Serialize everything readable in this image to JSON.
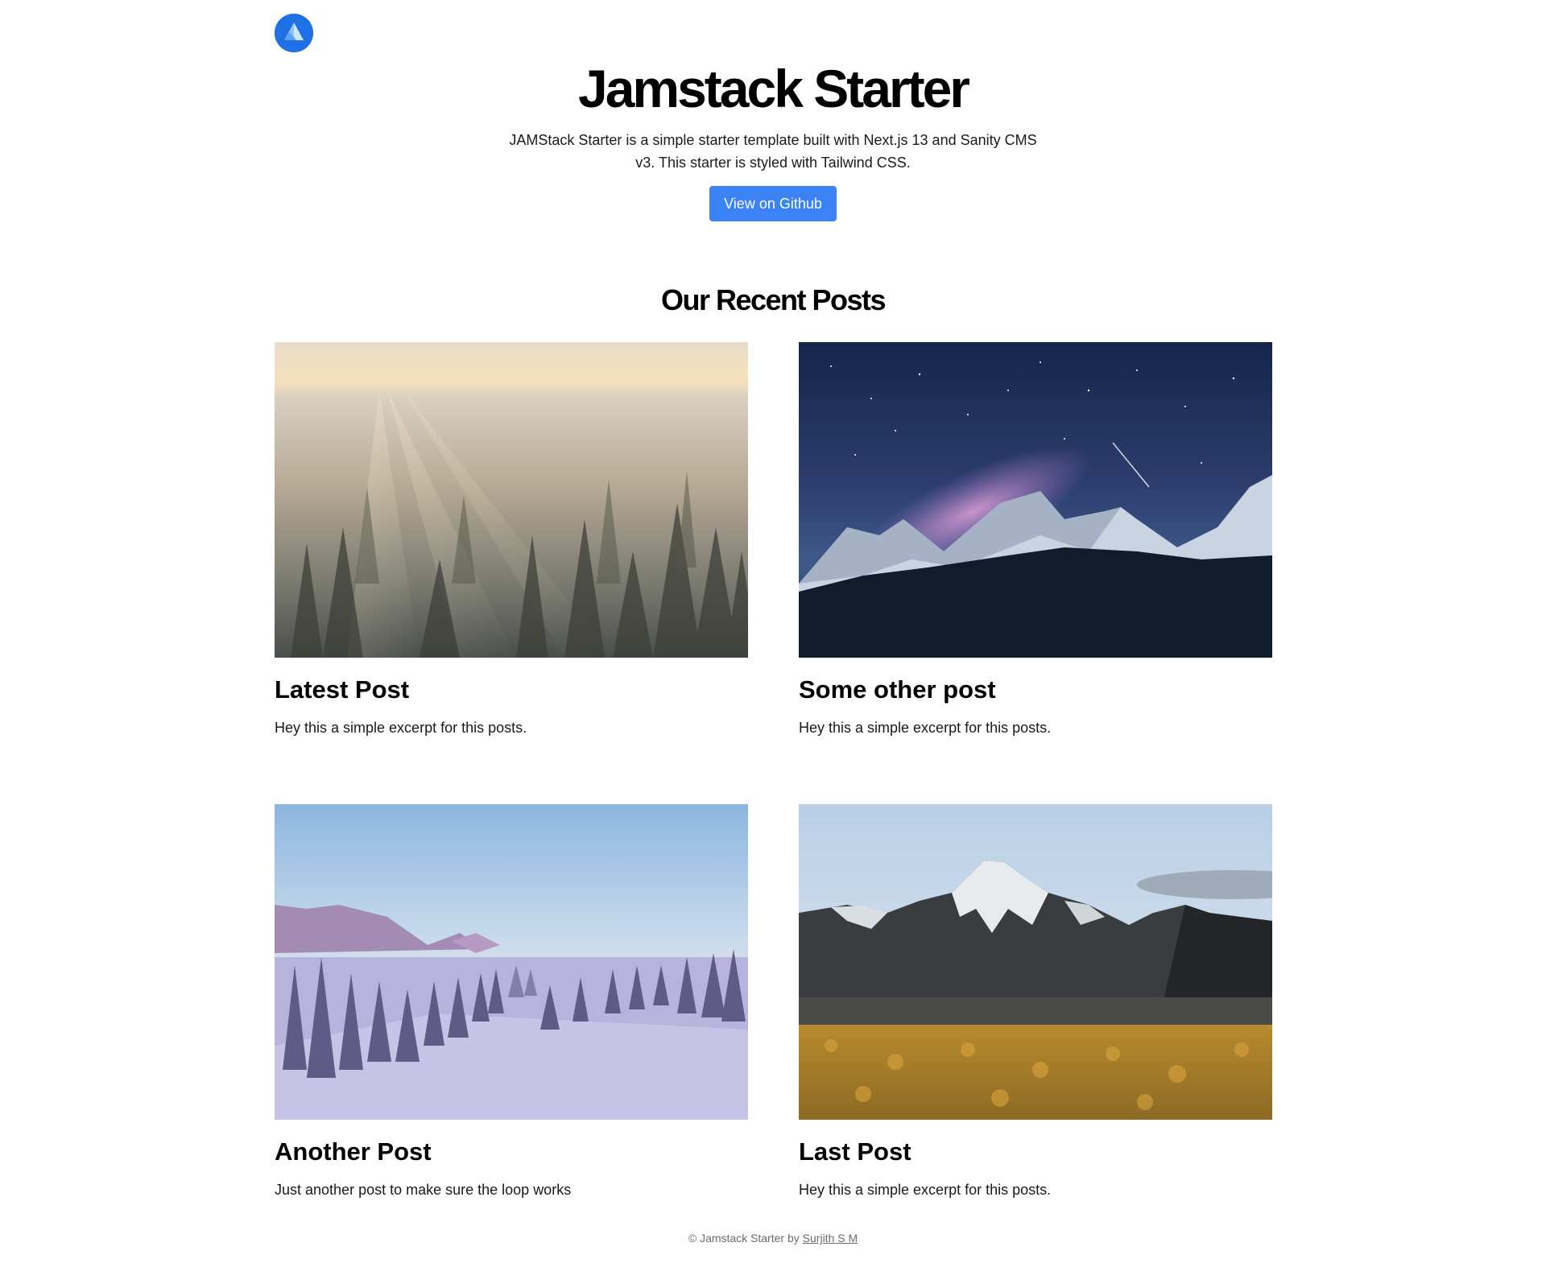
{
  "header": {
    "logo_icon": "mountain-logo-icon",
    "brand_color": "#1f6fe5"
  },
  "hero": {
    "title": "Jamstack Starter",
    "description": "JAMStack Starter is a simple starter template built with Next.js 13 and Sanity CMS v3. This starter is styled with Tailwind CSS.",
    "button_label": "View on Github",
    "button_color": "#3b82f6"
  },
  "posts_section": {
    "title": "Our Recent Posts",
    "posts": [
      {
        "title": "Latest Post",
        "excerpt": "Hey this a simple excerpt for this posts.",
        "image": "misty-forest-sunrise-photo"
      },
      {
        "title": "Some other post",
        "excerpt": "Hey this a simple excerpt for this posts.",
        "image": "milky-way-mountains-photo"
      },
      {
        "title": "Another Post",
        "excerpt": "Just another post to make sure the loop works",
        "image": "snowy-forest-valley-photo"
      },
      {
        "title": "Last Post",
        "excerpt": "Hey this a simple excerpt for this posts.",
        "image": "snow-peak-golden-field-photo"
      }
    ]
  },
  "footer": {
    "text": "© Jamstack Starter by",
    "author_link": "Surjith S M"
  }
}
